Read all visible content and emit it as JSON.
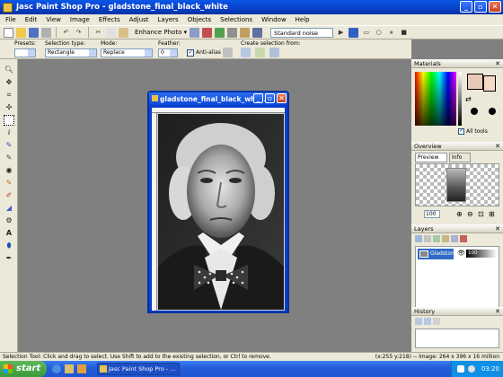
{
  "app": {
    "title": "Jasc Paint Shop Pro - gladstone_final_black_white",
    "menu": [
      "File",
      "Edit",
      "View",
      "Image",
      "Effects",
      "Adjust",
      "Layers",
      "Objects",
      "Selections",
      "Window",
      "Help"
    ]
  },
  "toolbar": {
    "enhance_label": "Enhance Photo",
    "noise_label": "Standard noise reduction"
  },
  "tool_options": {
    "presets_label": "Presets:",
    "selection_type_label": "Selection type:",
    "selection_type_value": "Rectangle",
    "mode_label": "Mode:",
    "mode_value": "Replace",
    "feather_label": "Feather:",
    "feather_value": "0",
    "antialias_label": "Anti-alias",
    "create_from_label": "Create selection from:"
  },
  "document": {
    "title": "gladstone_final_black_whit..."
  },
  "panels": {
    "materials_title": "Materials",
    "all_tools_label": "All tools",
    "overview_title": "Overview",
    "preview_tab": "Preview",
    "info_tab": "Info",
    "zoom_value": "100",
    "layers_title": "Layers",
    "layer_name": "Gladstone",
    "layer_opacity": "100",
    "history_title": "History"
  },
  "status": {
    "hint": "Selection Tool: Click and drag to select. Use Shift to add to the existing selection, or Ctrl to remove.",
    "info": "(x:255 y:218) -- Image: 264 x 396 x 16 million"
  },
  "taskbar": {
    "start_label": "start",
    "task_label": "Jasc Paint Shop Pro - ...",
    "clock": "03:20"
  },
  "colors": {
    "foreground": "#e8c9b8",
    "background": "#f6d9c6"
  }
}
